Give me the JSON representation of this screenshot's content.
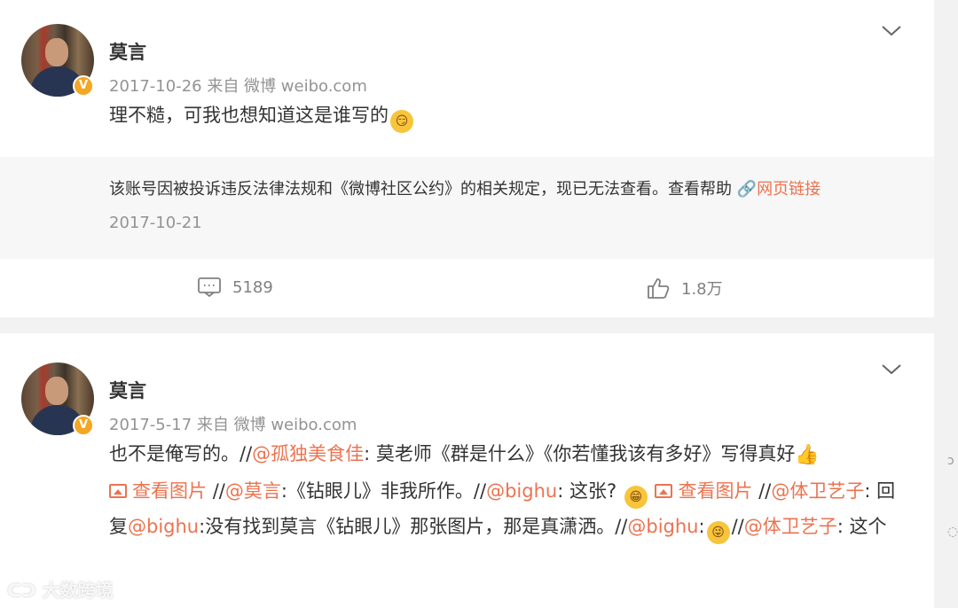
{
  "posts": [
    {
      "author": "莫言",
      "meta": "2017-10-26  来自 微博 weibo.com",
      "text_main": "理不糙，可我也想知道这是谁写的",
      "emoji_1": "😏",
      "retweet_notice": "该账号因被投诉违反法律法规和《微博社区公约》的相关规定，现已无法查看。查看帮助",
      "retweet_link": "网页链接",
      "retweet_date": "2017-10-21",
      "comment_count": "5189",
      "like_count": "1.8万"
    },
    {
      "author": "莫言",
      "meta": "2017-5-17  来自 微博 weibo.com",
      "seg1": "也不是俺写的。//",
      "mention1": "@孤独美食佳",
      "seg2": ": 莫老师《群是什么》《你若懂我该有多好》写得真好",
      "view_image_1": "查看图片",
      "seg3": "//",
      "mention2": "@莫言",
      "seg4": ":《钻眼儿》非我所作。//",
      "mention3": "@bighu",
      "seg5": ": 这张?",
      "view_image_2": "查看图片",
      "seg6": "//",
      "mention4": "@体卫艺子",
      "seg7": ": 回复",
      "mention5": "@bighu",
      "seg8": ":没有找到莫言《钻眼儿》那张图片，那是真潇洒。//",
      "mention6": "@bighu",
      "seg9": ":",
      "seg10": "//",
      "mention7": "@体卫艺子",
      "seg11": ": 这个"
    }
  ],
  "watermark": "大数跨境",
  "colors": {
    "link": "#eb7350",
    "meta": "#939393",
    "verified": "#f5a623"
  },
  "icons": [
    "chevron-down-icon",
    "comment-icon",
    "like-icon",
    "link-icon",
    "image-icon",
    "verified-badge-icon"
  ]
}
